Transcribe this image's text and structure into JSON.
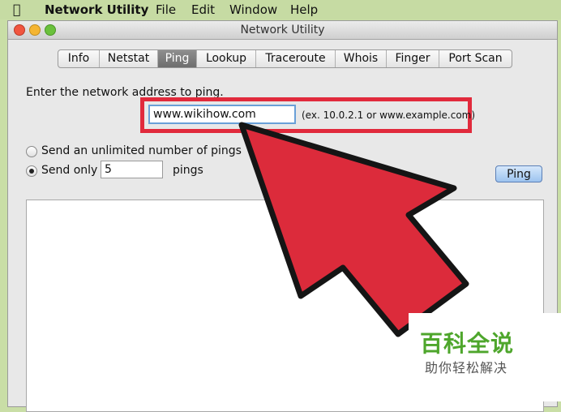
{
  "menubar": {
    "app_name": "Network Utility",
    "menus": [
      "File",
      "Edit",
      "Window",
      "Help"
    ]
  },
  "window": {
    "title": "Network Utility"
  },
  "tabs": [
    {
      "label": "Info"
    },
    {
      "label": "Netstat"
    },
    {
      "label": "Ping",
      "active": true
    },
    {
      "label": "Lookup"
    },
    {
      "label": "Traceroute"
    },
    {
      "label": "Whois"
    },
    {
      "label": "Finger"
    },
    {
      "label": "Port Scan"
    }
  ],
  "ping": {
    "instruction": "Enter the network address to ping.",
    "address_value": "www.wikihow.com",
    "example_hint": "(ex. 10.0.2.1 or www.example.com)",
    "option_unlimited": "Send an unlimited number of pings",
    "option_only": "Send only",
    "count_value": "5",
    "count_suffix": "pings",
    "selected_option": "only",
    "button_label": "Ping"
  },
  "overlay": {
    "arrow_color": "#dc2b3b",
    "highlight_color": "#e12a3c",
    "watermark_title": "百科全说",
    "watermark_subtitle": "助你轻松解决",
    "watermark_color": "#4ea62c"
  }
}
